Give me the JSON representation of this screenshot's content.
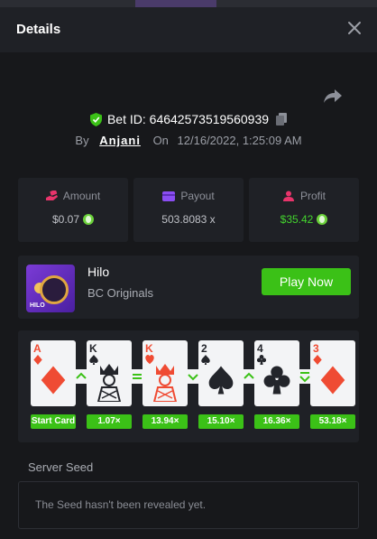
{
  "modal": {
    "title": "Details"
  },
  "bet": {
    "id_label": "Bet ID: 64642573519560939",
    "by": "By",
    "user": "Anjani",
    "on": "On",
    "date": "12/16/2022, 1:25:09 AM"
  },
  "stats": [
    {
      "label": "Amount",
      "value": "$0.07",
      "icon": "money-hand-icon",
      "color": "#e8346b"
    },
    {
      "label": "Payout",
      "value": "503.8083 x",
      "icon": "wallet-icon",
      "color": "#8a4df2"
    },
    {
      "label": "Profit",
      "value": "$35.42",
      "icon": "users-icon",
      "color": "#e8346b"
    }
  ],
  "game": {
    "name": "Hilo",
    "provider": "BC Originals",
    "thumb_label": "HILO",
    "play_label": "Play Now"
  },
  "cards": [
    {
      "rank": "A",
      "suit": "diamond",
      "color": "red",
      "label": "Start Card"
    },
    {
      "rank": "K",
      "suit": "spade",
      "color": "black",
      "label": "1.07×"
    },
    {
      "rank": "K",
      "suit": "heart",
      "color": "red",
      "label": "13.94×"
    },
    {
      "rank": "2",
      "suit": "spade",
      "color": "black",
      "label": "15.10×"
    },
    {
      "rank": "4",
      "suit": "club",
      "color": "black",
      "label": "16.36×"
    },
    {
      "rank": "3",
      "suit": "diamond",
      "color": "red",
      "label": "53.18×"
    }
  ],
  "guesses": [
    "higher",
    "same",
    "lower",
    "higher",
    "same-or-lower"
  ],
  "seed": {
    "label": "Server Seed",
    "message": "The Seed hasn't been revealed yet."
  },
  "colors": {
    "accent_green": "#3bc117",
    "background": "#17181b",
    "panel": "#1f2126"
  }
}
